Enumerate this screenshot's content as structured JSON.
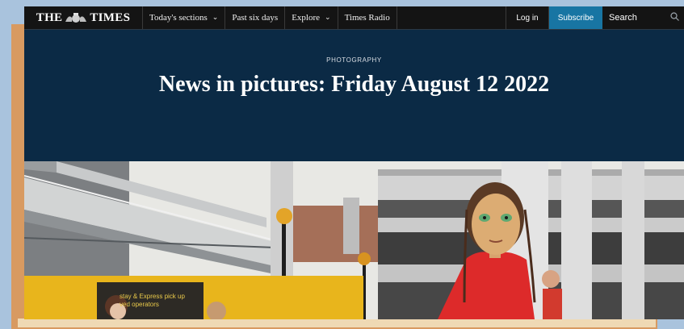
{
  "nav": {
    "logo_left": "THE",
    "logo_right": "TIMES",
    "items": [
      {
        "label": "Today's sections",
        "has_chevron": true
      },
      {
        "label": "Past six days",
        "has_chevron": false
      },
      {
        "label": "Explore",
        "has_chevron": true
      },
      {
        "label": "Times Radio",
        "has_chevron": false
      }
    ],
    "login_label": "Log in",
    "subscribe_label": "Subscribe",
    "search_placeholder": "Search"
  },
  "header": {
    "kicker": "PHOTOGRAPHY",
    "title": "News in pictures: Friday August 12 2022"
  },
  "photo": {
    "sign_line1": "stay & Express pick up",
    "sign_line2": "ved operators"
  },
  "colors": {
    "nav_bg": "#141414",
    "header_bg": "#0b2a45",
    "subscribe_bg": "#1875a3",
    "frame_orange": "#d89a61",
    "background": "#a9c3dd"
  },
  "icons": {
    "crest": "royal-crest-icon",
    "chevron": "chevron-down-icon",
    "search": "search-icon"
  }
}
